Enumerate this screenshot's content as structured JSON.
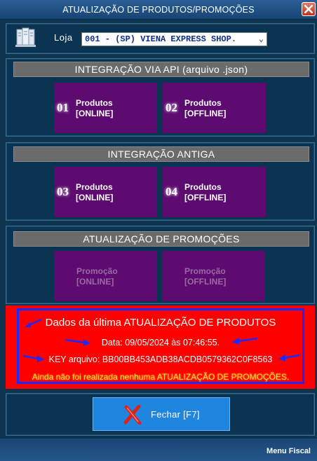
{
  "window": {
    "title": "ATUALIZAÇÃO DE PRODUTOS/PROMOÇÕES",
    "close_icon": "close-x-icon"
  },
  "store": {
    "label": "Loja",
    "selected": "001 - (SP) VIENA EXPRESS SHOP.",
    "icon": "server-icon"
  },
  "api_section": {
    "header": "INTEGRAÇÃO VIA API (arquivo .json)",
    "tiles": [
      {
        "number": "01",
        "line1": "Produtos",
        "line2": "[ONLINE]"
      },
      {
        "number": "02",
        "line1": "Produtos",
        "line2": "[OFFLINE]"
      }
    ]
  },
  "legacy_section": {
    "header": "INTEGRAÇÃO ANTIGA",
    "tiles": [
      {
        "number": "03",
        "line1": "Produtos",
        "line2": "[ONLINE]"
      },
      {
        "number": "04",
        "line1": "Produtos",
        "line2": "[OFFLINE]"
      }
    ]
  },
  "promo_section": {
    "header": "ATUALIZAÇÃO DE PROMOÇÕES",
    "tiles": [
      {
        "line1": "Promoção",
        "line2": "[ONLINE]",
        "enabled": false
      },
      {
        "line1": "Promoção",
        "line2": "[OFFLINE]",
        "enabled": false
      }
    ]
  },
  "last_update": {
    "title": "Dados da última ATUALIZAÇÃO DE PRODUTOS",
    "date": "Data: 09/05/2024 às 07:46:55.",
    "key": "KEY arquivo:  BB00BB453ADB38ACDB0579362C0F8563",
    "promo_status": "Ainda não foi realizada nenhuma ATUALIZAÇÃO DE PROMOÇÕES."
  },
  "close_button": {
    "label": "Fechar [F7]",
    "icon": "red-x-icon"
  },
  "statusbar": {
    "menu": "Menu Fiscal"
  },
  "colors": {
    "background": "#0f3450",
    "tile": "#5d0b71",
    "info_panel": "#ff0000",
    "info_border": "#1a2aff",
    "close_button": "#1f86df",
    "section_header": "#6b6b6b"
  }
}
